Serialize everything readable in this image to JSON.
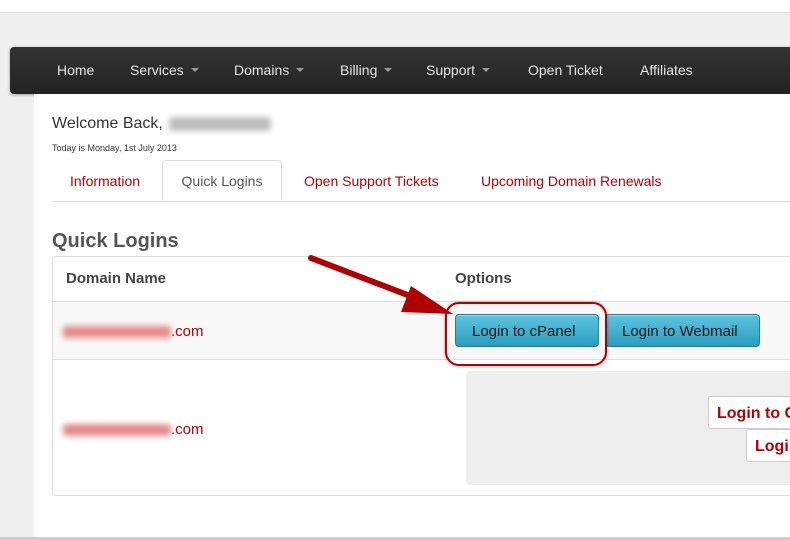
{
  "nav": {
    "items": [
      {
        "label": "Home",
        "dropdown": false
      },
      {
        "label": "Services",
        "dropdown": true
      },
      {
        "label": "Domains",
        "dropdown": true
      },
      {
        "label": "Billing",
        "dropdown": true
      },
      {
        "label": "Support",
        "dropdown": true
      },
      {
        "label": "Open Ticket",
        "dropdown": false
      },
      {
        "label": "Affiliates",
        "dropdown": false
      }
    ]
  },
  "welcome": {
    "prefix": "Welcome Back,",
    "date": "Today is Monday, 1st July 2013"
  },
  "tabs": [
    {
      "label": "Information",
      "active": false
    },
    {
      "label": "Quick Logins",
      "active": true
    },
    {
      "label": "Open Support Tickets",
      "active": false
    },
    {
      "label": "Upcoming Domain Renewals",
      "active": false
    }
  ],
  "quick_logins": {
    "title": "Quick Logins",
    "columns": [
      "Domain Name",
      "Options"
    ],
    "rows": [
      {
        "domain_suffix": ".com",
        "buttons": [
          "Login to cPanel",
          "Login to Webmail"
        ]
      },
      {
        "domain_suffix": ".com",
        "buttons": [
          "Login to C",
          "Logi"
        ]
      }
    ]
  },
  "colors": {
    "accent": "#b30000",
    "button": "#2a9dc0",
    "navbar": "#2b2b2b"
  }
}
